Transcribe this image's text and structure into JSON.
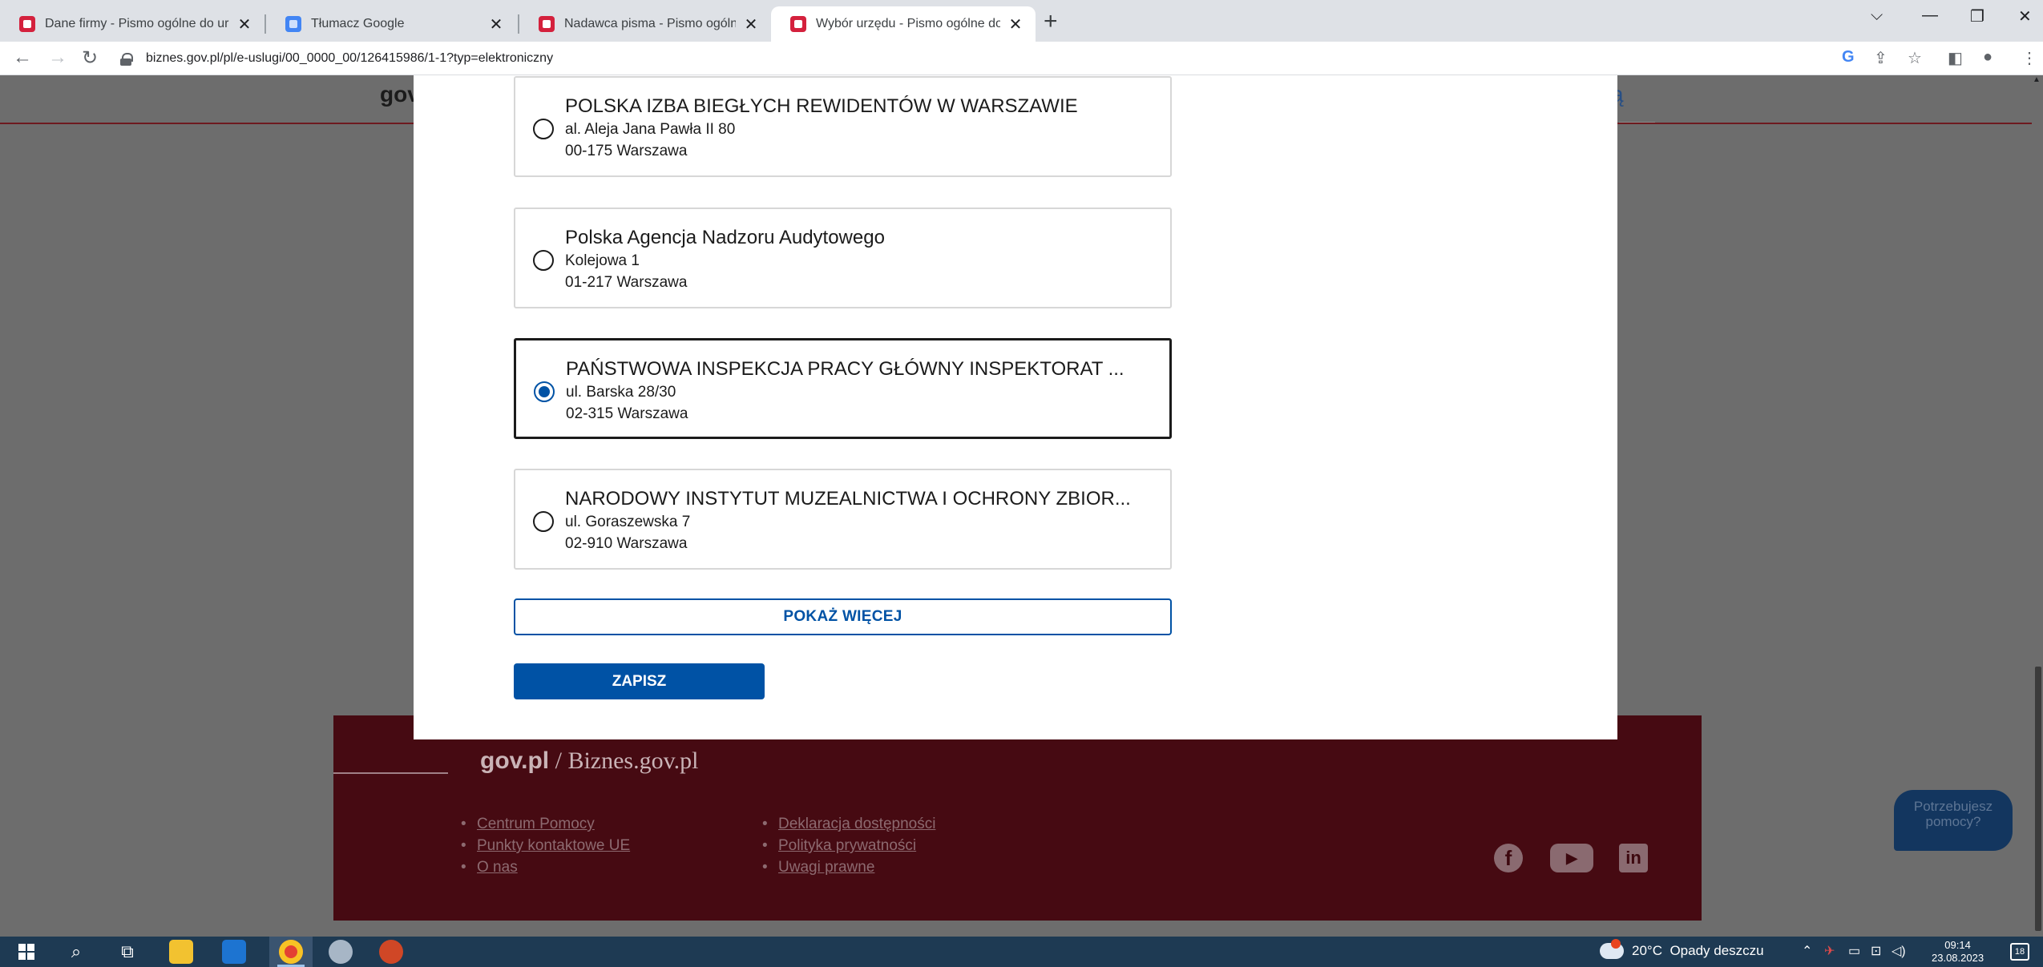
{
  "browser": {
    "tabs": [
      {
        "title": "Dane firmy - Pismo ogólne do ur",
        "favicon": "biznes-gov-favicon",
        "active": false
      },
      {
        "title": "Tłumacz Google",
        "favicon": "google-translate-favicon",
        "active": false
      },
      {
        "title": "Nadawca pisma - Pismo ogólne d",
        "favicon": "biznes-gov-favicon",
        "active": false
      },
      {
        "title": "Wybór urzędu - Pismo ogólne do",
        "favicon": "biznes-gov-favicon",
        "active": true
      }
    ],
    "close_glyph": "✕",
    "new_tab_glyph": "+",
    "url": "biznes.gov.pl/pl/e-uslugi/00_0000_00/126415986/1-1?typ=elektroniczny"
  },
  "background_page": {
    "header_logo_fragment": "gov",
    "header_right_fragment": "ą",
    "footer": {
      "brand_bold": "gov.pl",
      "brand_rest": " / Biznes.gov.pl",
      "links_col1": [
        "Centrum Pomocy",
        "Punkty kontaktowe UE",
        "O nas"
      ],
      "links_col2": [
        "Deklaracja dostępności",
        "Polityka prywatności",
        "Uwagi prawne"
      ],
      "social_icons": [
        "facebook-icon",
        "youtube-icon",
        "linkedin-icon"
      ]
    },
    "help_bubble": "Potrzebujesz pomocy?"
  },
  "modal": {
    "options": [
      {
        "name": "POLSKA IZBA BIEGŁYCH REWIDENTÓW W WARSZAWIE",
        "line2": "al. Aleja Jana Pawła II 80",
        "line3": "00-175 Warszawa",
        "selected": false
      },
      {
        "name": "Polska Agencja Nadzoru Audytowego",
        "line2": "Kolejowa 1",
        "line3": "01-217 Warszawa",
        "selected": false
      },
      {
        "name": "PAŃSTWOWA INSPEKCJA PRACY GŁÓWNY INSPEKTORAT ...",
        "line2": "ul. Barska 28/30",
        "line3": "02-315 Warszawa",
        "selected": true
      },
      {
        "name": "NARODOWY INSTYTUT MUZEALNICTWA I OCHRONY ZBIOR...",
        "line2": "ul. Goraszewska 7",
        "line3": "02-910 Warszawa",
        "selected": false
      }
    ],
    "show_more_label": "POKAŻ WIĘCEJ",
    "save_label": "ZAPISZ"
  },
  "taskbar": {
    "weather_temp": "20°C",
    "weather_text": "Opady deszczu",
    "time": "09:14",
    "date": "23.08.2023",
    "notification_count": "18"
  },
  "colors": {
    "accent_blue": "#0052a5",
    "footer_bg": "#460a12",
    "taskbar_bg": "#1e3a53"
  }
}
